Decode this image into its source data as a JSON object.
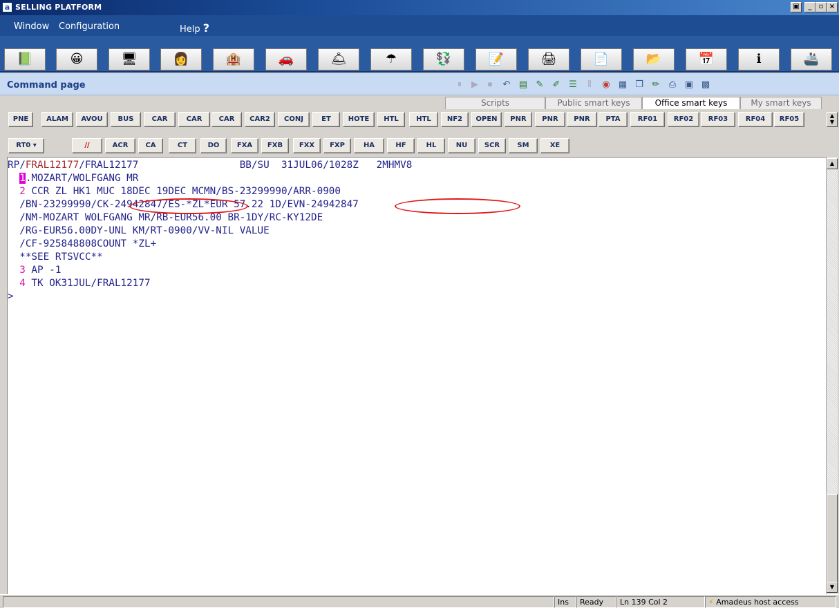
{
  "window": {
    "app_icon": "a",
    "title": "SELLING PLATFORM",
    "controls": [
      "🗗",
      "_",
      "🗗",
      "×"
    ]
  },
  "menu": {
    "window": "Window",
    "configuration": "Configuration",
    "help": "Help",
    "help_icon": "?"
  },
  "toolbar_icons": [
    {
      "name": "book-icon",
      "glyph": "📗"
    },
    {
      "name": "face-icon",
      "glyph": "😀"
    },
    {
      "name": "terminal-icon",
      "glyph": "🖥"
    },
    {
      "name": "agent-icon",
      "glyph": "👩"
    },
    {
      "name": "hotel-icon",
      "glyph": "🏨"
    },
    {
      "name": "car-icon",
      "glyph": "🚗"
    },
    {
      "name": "bellboy-icon",
      "glyph": "🛎"
    },
    {
      "name": "umbrella-icon",
      "glyph": "☂"
    },
    {
      "name": "money-icon",
      "glyph": "💱"
    },
    {
      "name": "notepad-icon",
      "glyph": "📝"
    },
    {
      "name": "printer-icon",
      "glyph": "🖨"
    },
    {
      "name": "document-icon",
      "glyph": "📄"
    },
    {
      "name": "folder-icon",
      "glyph": "📂"
    },
    {
      "name": "calendar-icon",
      "glyph": "📅"
    },
    {
      "name": "info-icon",
      "glyph": "ℹ"
    },
    {
      "name": "cruise-icon",
      "glyph": "🚢"
    }
  ],
  "command_page": {
    "title": "Command page"
  },
  "tabs": [
    "Scripts",
    "Public smart keys",
    "Office smart keys",
    "My smart keys"
  ],
  "smart_keys_row1": [
    "PNE",
    "ALAM",
    "AVOU",
    "BUS",
    "CAR",
    "CAR",
    "CAR",
    "CAR2",
    "CONJ",
    "ET",
    "HOTE",
    "HTL",
    "HTL",
    "NF2",
    "OPEN",
    "PNR",
    "PNR",
    "PNR",
    "PTA",
    "RF01",
    "RF02",
    "RF03",
    "RF04",
    "RF05"
  ],
  "smart_keys_row2": [
    "RT0 ▾",
    "//",
    "ACR",
    "CA",
    "CT",
    "DO",
    "FXA",
    "FXB",
    "FXX",
    "FXP",
    "HA",
    "HF",
    "HL",
    "NU",
    "SCR",
    "SM",
    "XE"
  ],
  "terminal": {
    "header_prefix": "RP/",
    "header_office": "FRAL12177",
    "header_rest": "/FRAL12177                 BB/SU  31JUL06/1028Z   2MHMV8",
    "line1_num": "1",
    "line1_text": ".MOZART/WOLFGANG MR",
    "line2_num": "2",
    "line2_text": " CCR ZL HK1 MUC 18DEC 19DEC MCMN/BS-23299990/ARR-0900",
    "line3": "  /BN-23299990/CK-24942847/ES-*ZL*EUR 57.22 1D/EVN-24942847",
    "line4": "  /NM-MOZART WOLFGANG MR/RB-EUR56.00 BR-1DY/RC-KY12DE",
    "line5": "  /RG-EUR56.00DY-UNL KM/RT-0900/VV-NIL VALUE",
    "line6": "  /CF-925848808COUNT *ZL+",
    "line7": "  **SEE RTSVCC**",
    "line8_num": "3",
    "line8_text": " AP -1",
    "line9_num": "4",
    "line9_text": " TK OK31JUL/FRAL12177",
    "prompt": ">"
  },
  "statusbar": {
    "mode": "Ins",
    "state": "Ready",
    "position": "Ln 139 Col 2",
    "connection": "Amadeus host access"
  }
}
